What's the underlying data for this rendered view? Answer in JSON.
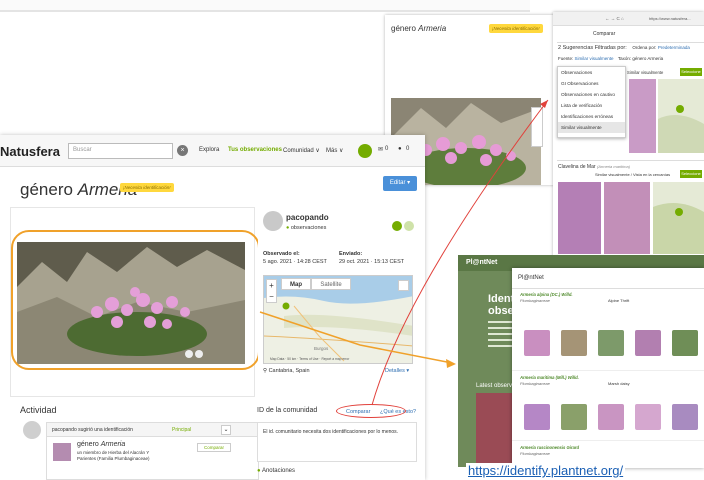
{
  "natusfera": {
    "logo": "Natusfera",
    "search_placeholder": "Buscar",
    "nav": [
      "Explora",
      "Tus observaciones",
      "Comunidad ∨",
      "Más ∨"
    ],
    "counts": [
      "0",
      "0"
    ],
    "title_prefix": "género",
    "title_taxon": "Armeria",
    "badge": "¡Necesita identificación!",
    "edit_label": "Editar",
    "user": "pacopando",
    "user_sub": "observaciones",
    "observed_label": "Observado el:",
    "observed_value": "5 ago. 2021 · 14:28 CEST",
    "sent_label": "Enviado:",
    "sent_value": "29 oct. 2021 · 15:13 CEST",
    "map_tabs": [
      "Map",
      "Satellite"
    ],
    "place": "Cantabria, Spain",
    "details": "Detalles ▾",
    "activity_title": "Actividad",
    "activity_user": "pacopando sugirió una identificación",
    "activity_principal": "Principal",
    "activity_taxon_prefix": "género",
    "activity_taxon": "Armeria",
    "activity_desc1": "un miembro de Hierba del Alacrán Y",
    "activity_desc2": "Parientes (Familia Plumbaginaceae)",
    "compare_btn": "Comparar",
    "community_title": "ID de la comunidad",
    "community_compare": "Comparar",
    "community_what": "¿Qué es esto?",
    "community_text": "El id. comunitario necesita dos identificaciones por lo menos.",
    "annotations": "Anotaciones",
    "map_data": "Map Data",
    "map_scale": "50 km",
    "terms": "Terms of Use",
    "report": "Report a map error",
    "map_city": "Burgos"
  },
  "compare_panel": {
    "title_prefix": "género",
    "title_taxon": "Armeria",
    "badge": "¡Necesita identificación!",
    "browser_url": "https://www.natusfera...",
    "header": "Comparar",
    "suggestions": "2 Sugerencias Filtradas por:",
    "sort_label": "Ordena por:",
    "sort_value": "Predeterminada",
    "source_label": "Fuente:",
    "source_value": "Similar visualmente",
    "taxon_label": "Taxón:",
    "taxon_value": "género Armeria",
    "menu": [
      "Observaciones",
      "GI Observaciones",
      "Observaciones en cautivo",
      "Lista de verificación",
      "Identificaciones erróneas",
      "Similar visualmente"
    ],
    "similar_label": "Similar visualmente",
    "select_label": "Seleccione",
    "result2": "Clavelina de Mar",
    "result2_latin": "(Armeria maritima)",
    "result2_sub": "Similar visualmente / Vista en la cercanías"
  },
  "plantnet": {
    "logo": "Pl@ntNet",
    "modal_title": "Pl@ntNet",
    "heading1": "Ident",
    "heading2": "obse",
    "latest": "Latest observ",
    "species": [
      {
        "name": "Armeria alpina (DC.) Willd.",
        "family": "Plumbaginaceae",
        "common": "Alpine Thrift"
      },
      {
        "name": "Armeria maritima (Mill.) Willd.",
        "family": "Plumbaginaceae",
        "common": "Marsh daisy"
      },
      {
        "name": "Armeria ruscinonensis Girard",
        "family": "Plumbaginaceae",
        "common": ""
      }
    ],
    "url": "https://identify.plantnet.org/"
  },
  "colors": {
    "accent": "#74ac00",
    "edit": "#4a90d9",
    "badge": "#ffd83d",
    "highlight_ring": "#f0a12a",
    "arrow": "#e1413b"
  }
}
